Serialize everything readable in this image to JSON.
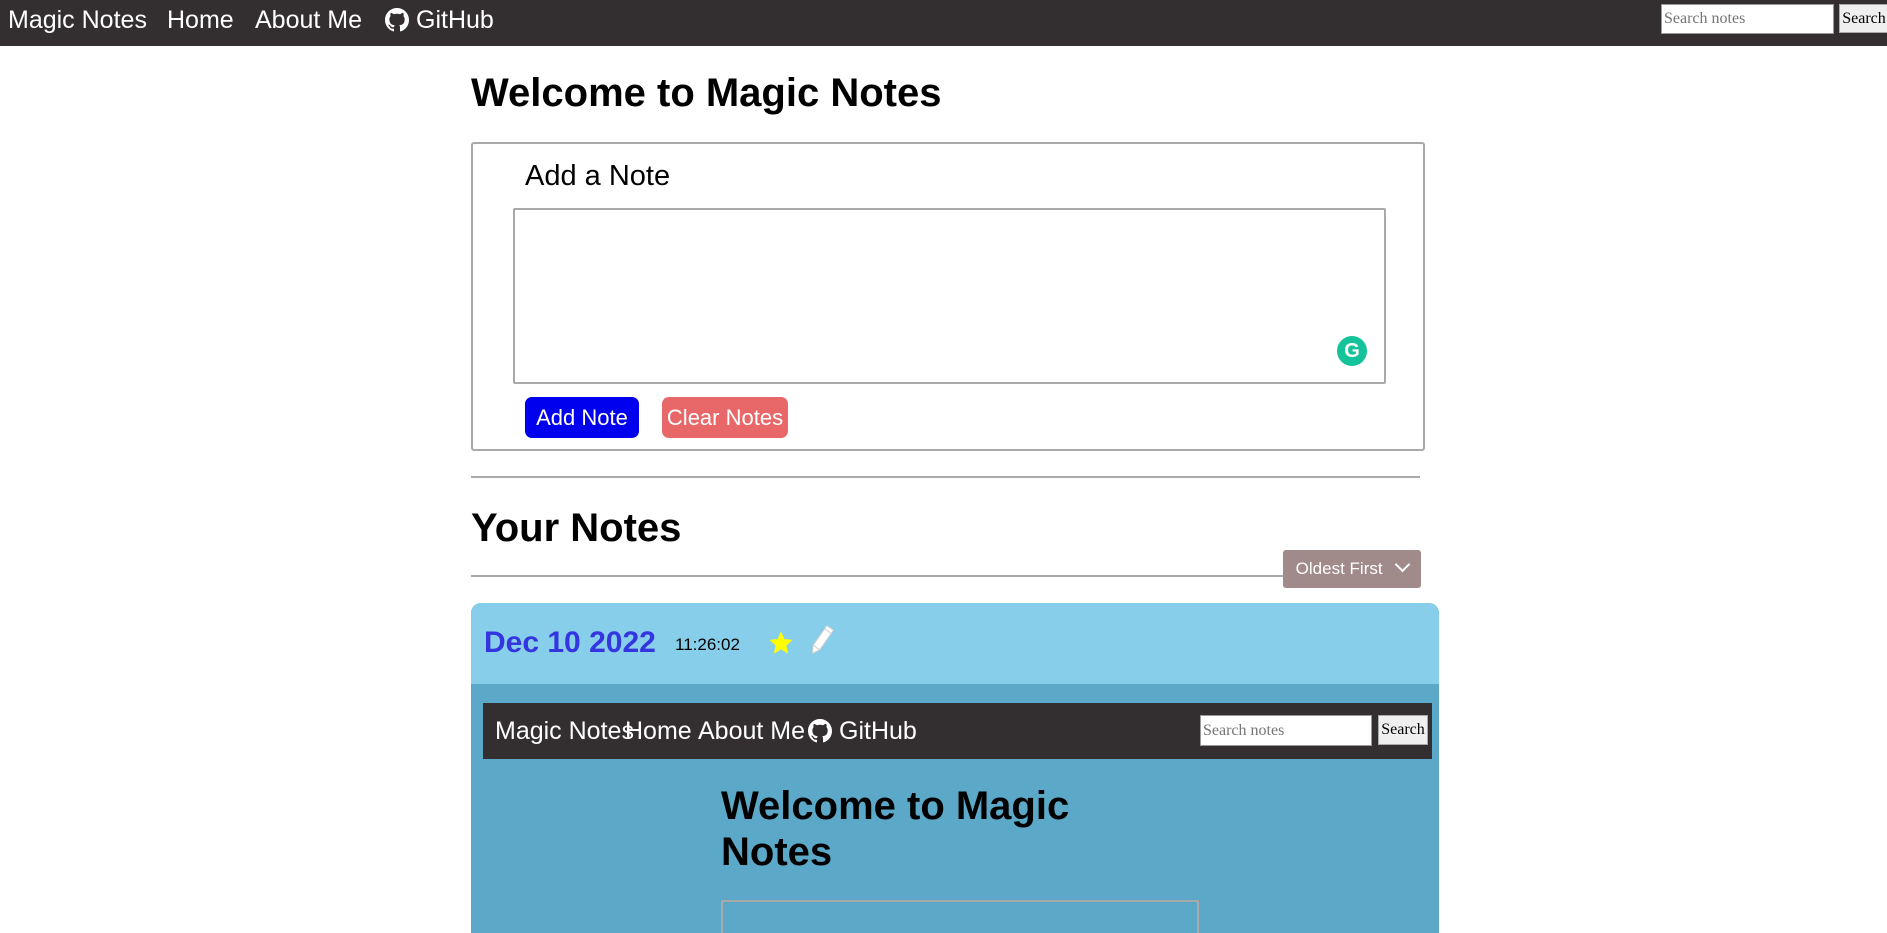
{
  "nav": {
    "brand": "Magic Notes",
    "home": "Home",
    "about": "About Me",
    "github": "GitHub",
    "github_icon": "github-icon",
    "search_placeholder": "Search notes",
    "search_button": "Search",
    "background": "#332f31"
  },
  "main": {
    "title": "Welcome to Magic Notes",
    "add_note": {
      "title": "Add a Note",
      "textarea_value": "",
      "grammarly_icon": "grammarly-icon",
      "add_button": "Add Note",
      "clear_button": "Clear Notes",
      "add_color": "#0000ee",
      "clear_color": "#e8686a"
    },
    "notes_title": "Your Notes",
    "sort_button": "Oldest First",
    "sort_icon": "chevron-down-icon"
  },
  "notes": [
    {
      "date": "Dec 10 2022",
      "time": "11:26:02",
      "star_icon": "star-icon",
      "edit_icon": "pencil-icon",
      "header_color": "#87ceea",
      "body_color": "#5ba8c8",
      "preview": {
        "brand": "Magic Notes",
        "home": "Home",
        "about": "About Me",
        "github": "GitHub",
        "search_placeholder": "Search notes",
        "search_button": "Search",
        "title": "Welcome to Magic Notes"
      }
    }
  ]
}
